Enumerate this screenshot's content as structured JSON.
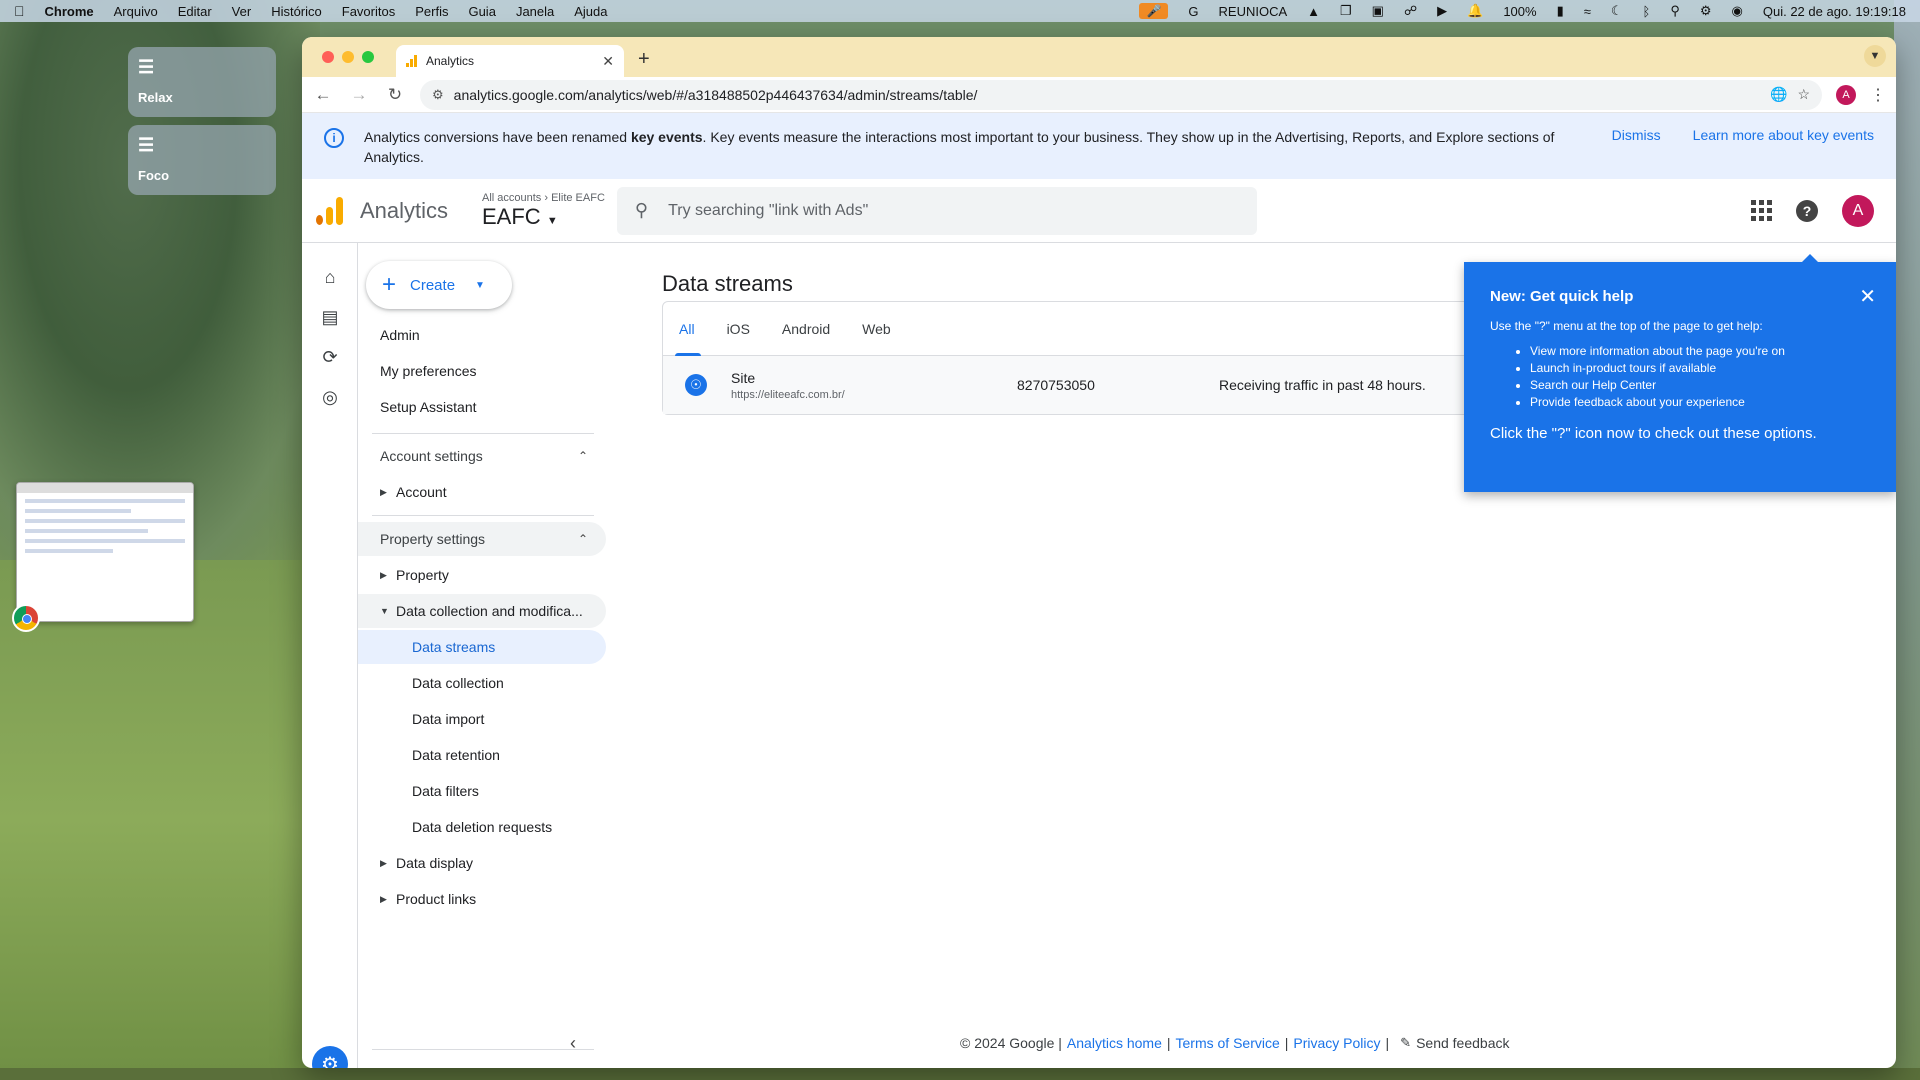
{
  "menubar": {
    "app": "Chrome",
    "menus": [
      "Arquivo",
      "Editar",
      "Ver",
      "Histórico",
      "Favoritos",
      "Perfis",
      "Guia",
      "Janela",
      "Ajuda"
    ],
    "status_app": "REUNIOCA",
    "battery": "100%",
    "datetime": "Qui. 22 de ago.  19:19:18"
  },
  "stage": {
    "tiles": [
      {
        "label": "Relax"
      },
      {
        "label": "Foco"
      }
    ]
  },
  "browser": {
    "tab_title": "Analytics",
    "url": "analytics.google.com/analytics/web/#/a318488502p446437634/admin/streams/table/",
    "profile_initial": "A"
  },
  "banner": {
    "text_before": "Analytics conversions have been renamed ",
    "text_bold": "key events",
    "text_after": ". Key events measure the interactions most important to your business. They show up in the Advertising, Reports, and Explore sections of Analytics.",
    "dismiss": "Dismiss",
    "learn_more": "Learn more about key events"
  },
  "header": {
    "product": "Analytics",
    "breadcrumb_root": "All accounts",
    "breadcrumb_account": "Elite EAFC",
    "property": "EAFC",
    "search_placeholder": "Try searching \"link with Ads\"",
    "avatar_initial": "A"
  },
  "nav": {
    "create": "Create",
    "admin": "Admin",
    "my_preferences": "My preferences",
    "setup_assistant": "Setup Assistant",
    "account_settings": "Account settings",
    "account": "Account",
    "property_settings": "Property settings",
    "property": "Property",
    "data_collection_mod": "Data collection and modifica...",
    "data_streams": "Data streams",
    "data_collection": "Data collection",
    "data_import": "Data import",
    "data_retention": "Data retention",
    "data_filters": "Data filters",
    "data_deletion": "Data deletion requests",
    "data_display": "Data display",
    "product_links": "Product links"
  },
  "main": {
    "title": "Data streams",
    "tabs": [
      "All",
      "iOS",
      "Android",
      "Web"
    ],
    "stream": {
      "name": "Site",
      "url": "https://eliteeafc.com.br/",
      "id": "8270753050",
      "status": "Receiving traffic in past 48 hours."
    }
  },
  "footer": {
    "copyright": "© 2024 Google |",
    "home": "Analytics home",
    "sep": "|",
    "tos": "Terms of Service",
    "privacy": "Privacy Policy",
    "feedback": "Send feedback"
  },
  "help_popup": {
    "title": "New: Get quick help",
    "intro": "Use the \"?\" menu at the top of the page to get help:",
    "items": [
      "View more information about the page you're on",
      "Launch in-product tours if available",
      "Search our Help Center",
      "Provide feedback about your experience"
    ],
    "cta": "Click the \"?\" icon now to check out these options."
  },
  "colors": {
    "accent": "#1a73e8",
    "banner_bg": "#e8f0fe",
    "tabstrip": "#f6e7b8",
    "avatar": "#c2185b"
  }
}
